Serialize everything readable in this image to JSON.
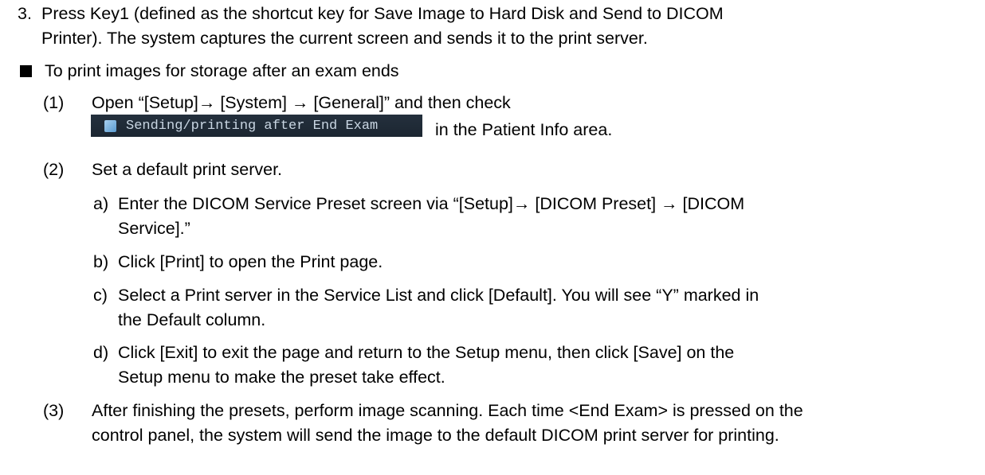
{
  "step3": {
    "number": "3.",
    "line1": "Press Key1 (defined as the shortcut key for Save Image to Hard Disk and Send to DICOM",
    "line2": "Printer). The system captures the current screen and sends it to the print server."
  },
  "section": {
    "bullet_title": "To print images for storage after an exam ends"
  },
  "step1": {
    "number": "(1)",
    "line1": "Open “[Setup]→ [System] → [General]” and then check",
    "ui_label": "Sending/printing after End Exam",
    "after_ui": "in the Patient Info area."
  },
  "step2": {
    "number": "(2)",
    "line1": "Set a default print server.",
    "a": {
      "letter": "a)",
      "line1": "Enter the DICOM Service Preset screen via “[Setup]→ [DICOM Preset] → [DICOM",
      "line2": "Service].”"
    },
    "b": {
      "letter": "b)",
      "line1": "Click [Print] to open the Print page."
    },
    "c": {
      "letter": "c)",
      "line1": "Select a Print server in the Service List and click [Default]. You will see “Y” marked in",
      "line2": "the Default column."
    },
    "d": {
      "letter": "d)",
      "line1": "Click [Exit] to exit the page and return to the Setup menu, then click [Save] on the",
      "line2": "Setup menu to make the preset take effect."
    }
  },
  "step3b": {
    "number": "(3)",
    "line1": "After finishing the presets, perform image scanning. Each time <End Exam> is pressed on the",
    "line2": "control panel, the system will send the image to the default DICOM print server for printing."
  },
  "colors": {
    "ui_bg": "#1f2a36",
    "ui_text": "#c9d6e3",
    "checkbox": "#7fb6e2"
  }
}
